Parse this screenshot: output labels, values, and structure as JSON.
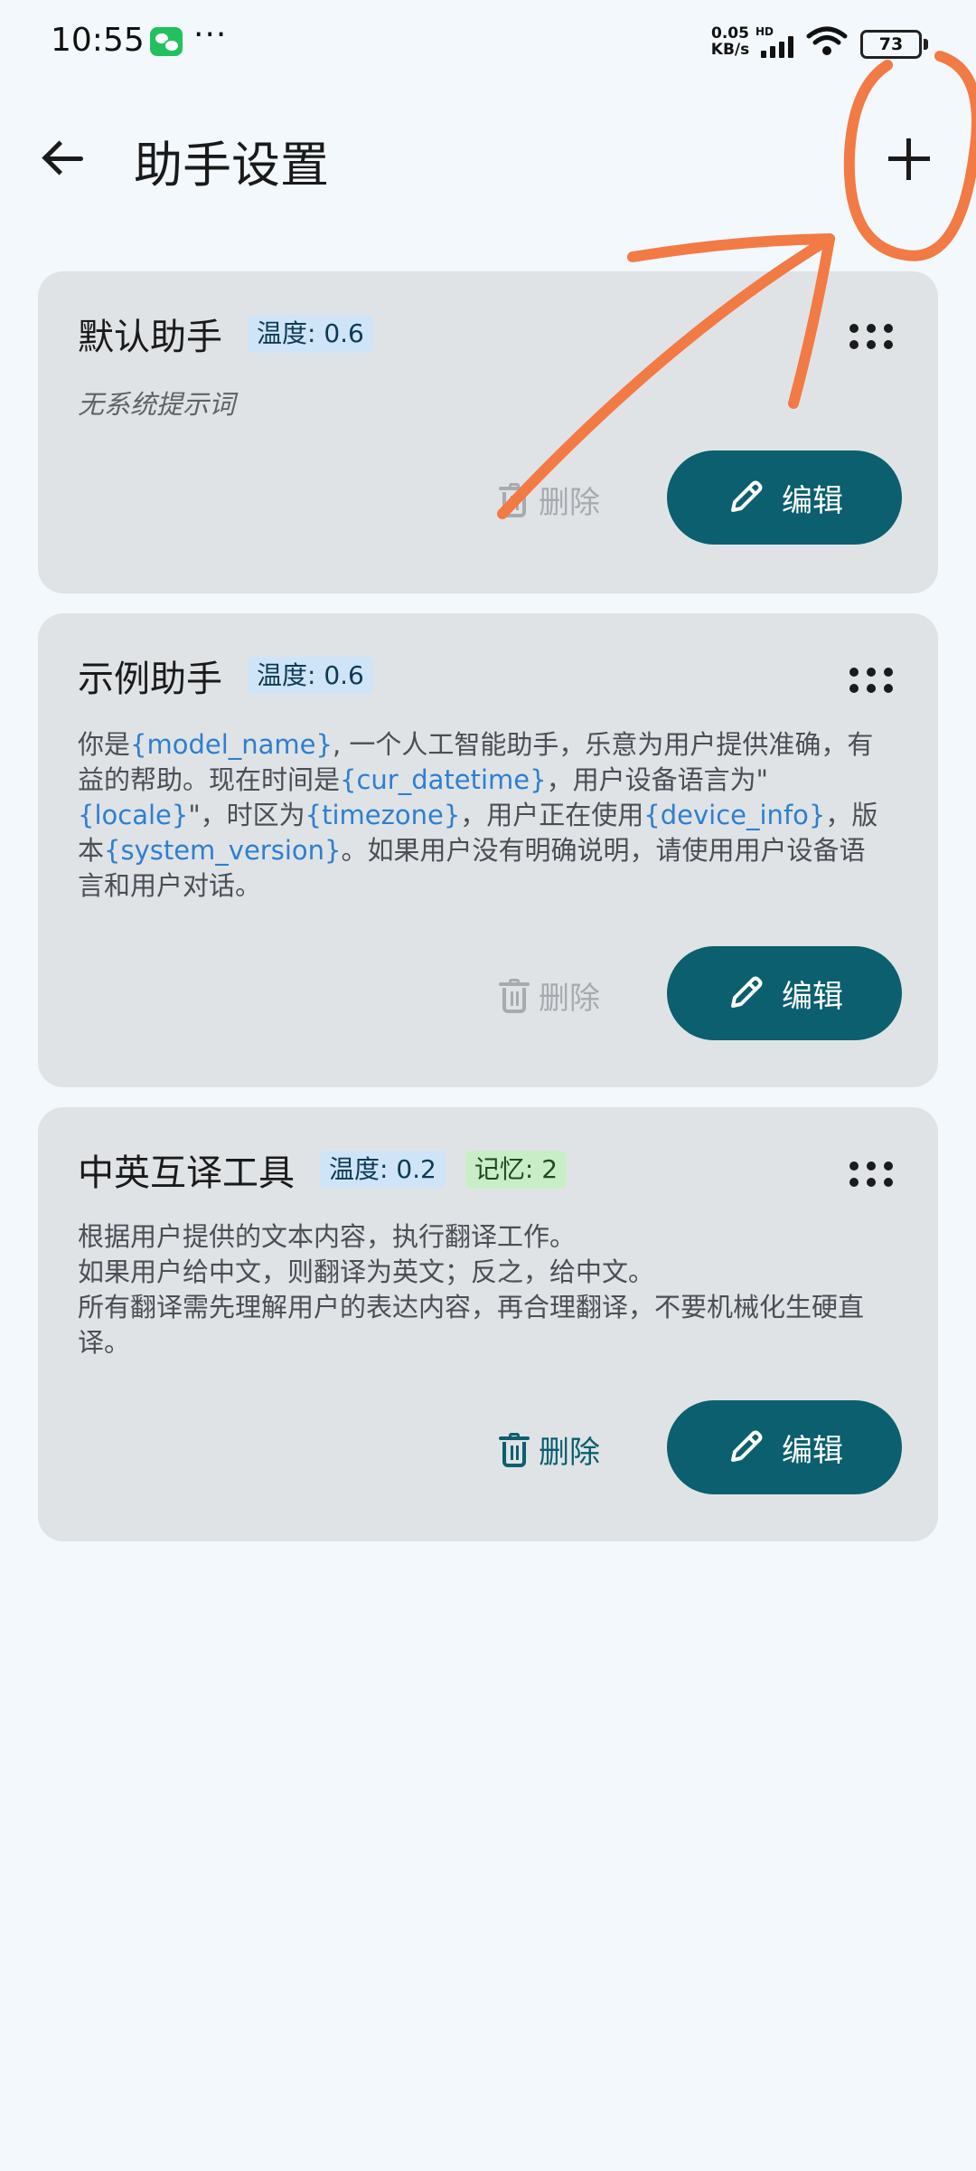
{
  "status_bar": {
    "time": "10:55",
    "more": "···",
    "net_speed_value": "0.05",
    "net_speed_unit": "KB/s",
    "hd": "HD",
    "battery": "73"
  },
  "app_bar": {
    "title": "助手设置"
  },
  "assistants": [
    {
      "name": "默认助手",
      "temperature": "温度: 0.6",
      "prompt_empty": "无系统提示词",
      "delete_label": "删除",
      "delete_enabled": false,
      "edit_label": "编辑"
    },
    {
      "name": "示例助手",
      "temperature": "温度: 0.6",
      "prompt_parts": [
        "你是",
        "{model_name}",
        ", 一个人工智能助手，乐意为用户提供准确，有益的帮助。现在时间是",
        "{cur_datetime}",
        "，用户设备语言为\"",
        "{locale}",
        "\"，时区为",
        "{timezone}",
        "，用户正在使用",
        "{device_info}",
        "，版本",
        "{system_version}",
        "。如果用户没有明确说明，请使用用户设备语言和用户对话。"
      ],
      "delete_label": "删除",
      "delete_enabled": false,
      "edit_label": "编辑"
    },
    {
      "name": "中英互译工具",
      "temperature": "温度: 0.2",
      "memory": "记忆: 2",
      "prompt_lines": [
        "根据用户提供的文本内容，执行翻译工作。",
        "如果用户给中文，则翻译为英文；反之，给中文。",
        "所有翻译需先理解用户的表达内容，再合理翻译，不要机械化生硬直译。"
      ],
      "delete_label": "删除",
      "delete_enabled": true,
      "edit_label": "编辑"
    }
  ],
  "colors": {
    "background": "#f2f8fb",
    "card": "#e0e3e6",
    "primary": "#0b5f6f",
    "variable_text": "#2e7fd0",
    "temp_badge": "#cfe5f7",
    "memory_badge": "#c9eec7",
    "annotation": "#f27a45"
  },
  "icons": [
    "back-arrow-icon",
    "add-icon",
    "drag-handle-icon",
    "trash-icon",
    "pencil-icon"
  ]
}
